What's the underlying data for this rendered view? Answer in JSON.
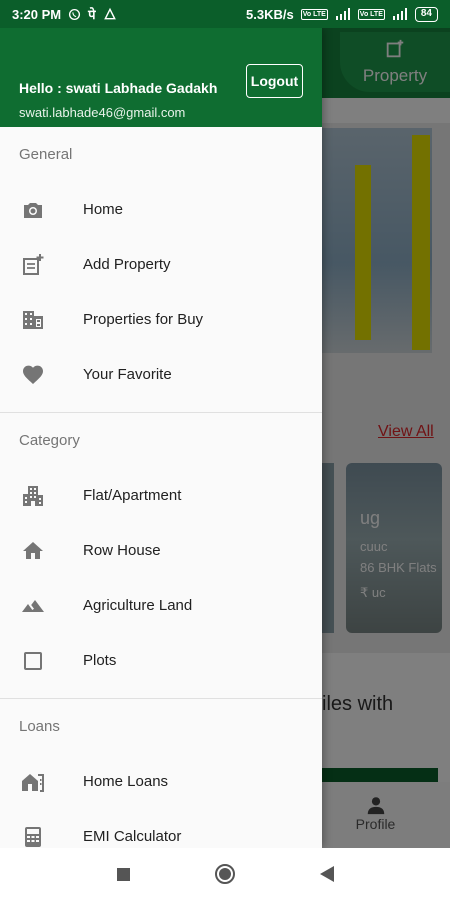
{
  "status_bar": {
    "time": "3:20 PM",
    "status_glyph": "पे",
    "net_speed": "5.3KB/s",
    "volte_label": "Vo LTE",
    "battery": "84"
  },
  "background": {
    "tab_label": "Property",
    "view_all": "View All",
    "card_title": "ug",
    "card_sub1": "cuuc",
    "card_sub2": "86 BHK Flats",
    "card_price": "₹ uc",
    "bottom_text": "iles with",
    "profile_label": "Profile"
  },
  "drawer": {
    "greeting": "Hello : swati Labhade Gadakh",
    "email": "swati.labhade46@gmail.com",
    "logout_label": "Logout",
    "sections": {
      "general": {
        "title": "General",
        "items": [
          {
            "label": "Home",
            "icon": "camera-icon"
          },
          {
            "label": "Add Property",
            "icon": "add-property-icon"
          },
          {
            "label": "Properties for Buy",
            "icon": "building-icon"
          },
          {
            "label": "Your Favorite",
            "icon": "heart-icon"
          }
        ]
      },
      "category": {
        "title": "Category",
        "items": [
          {
            "label": "Flat/Apartment",
            "icon": "apartment-icon"
          },
          {
            "label": "Row House",
            "icon": "home-icon"
          },
          {
            "label": "Agriculture Land",
            "icon": "landscape-icon"
          },
          {
            "label": "Plots",
            "icon": "checkbox-icon"
          }
        ]
      },
      "loans": {
        "title": "Loans",
        "items": [
          {
            "label": "Home Loans",
            "icon": "home-loan-icon"
          },
          {
            "label": "EMI Calculator",
            "icon": "calculator-icon"
          }
        ]
      }
    }
  },
  "colors": {
    "drawer_header": "#0f6d31",
    "status_bar": "#0b5e2a",
    "accent_red": "#e0262b"
  }
}
